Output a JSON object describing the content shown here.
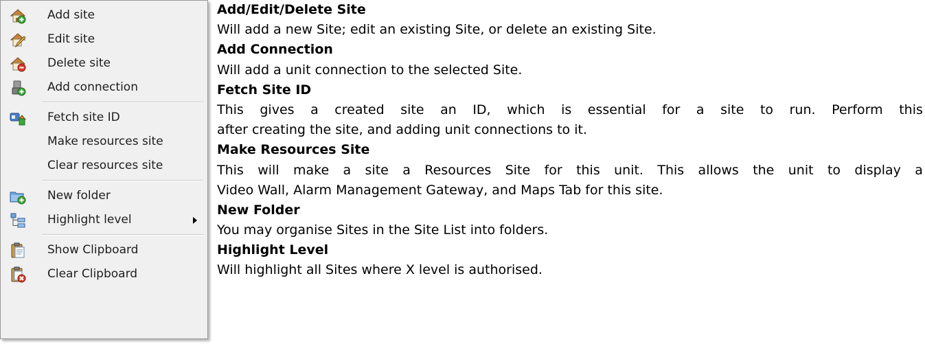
{
  "menu": {
    "items": [
      {
        "label": "Add site",
        "icon": "add-site-icon"
      },
      {
        "label": "Edit site",
        "icon": "edit-site-icon"
      },
      {
        "label": "Delete site",
        "icon": "delete-site-icon"
      },
      {
        "label": "Add connection",
        "icon": "add-connection-icon"
      },
      {
        "label": "Fetch site ID",
        "icon": "fetch-site-id-icon"
      },
      {
        "label": "Make resources site",
        "icon": ""
      },
      {
        "label": "Clear resources site",
        "icon": ""
      },
      {
        "label": "New folder",
        "icon": "new-folder-icon"
      },
      {
        "label": "Highlight level",
        "icon": "highlight-level-icon",
        "submenu": "submenu-arrow-icon"
      },
      {
        "label": "Show Clipboard",
        "icon": "show-clipboard-icon"
      },
      {
        "label": "Clear Clipboard",
        "icon": "clear-clipboard-icon"
      }
    ]
  },
  "descriptions": [
    {
      "heading": "Add/Edit/Delete Site",
      "text": [
        "Will add a new Site; edit an existing Site, or delete an existing Site."
      ]
    },
    {
      "heading": "Add Connection",
      "text": [
        "Will add a unit connection to the selected Site."
      ]
    },
    {
      "heading": "Fetch Site ID",
      "text": [
        "This gives a created site an ID, which is essential for a site to run. Perform this",
        "after creating the site, and adding unit connections to it."
      ]
    },
    {
      "heading": "Make Resources Site",
      "text": [
        "This will make a site a Resources Site for this unit. This allows the unit to display a",
        "Video Wall, Alarm Management Gateway, and Maps Tab for this site."
      ]
    },
    {
      "heading": "New Folder",
      "text": [
        "You may organise Sites in the Site List into folders."
      ]
    },
    {
      "heading": "Highlight Level",
      "text": [
        "Will highlight all Sites where X level is authorised."
      ]
    }
  ],
  "colors": {
    "menu_bg": "#f0f0f0",
    "menu_border": "#979797",
    "text": "#000000"
  }
}
